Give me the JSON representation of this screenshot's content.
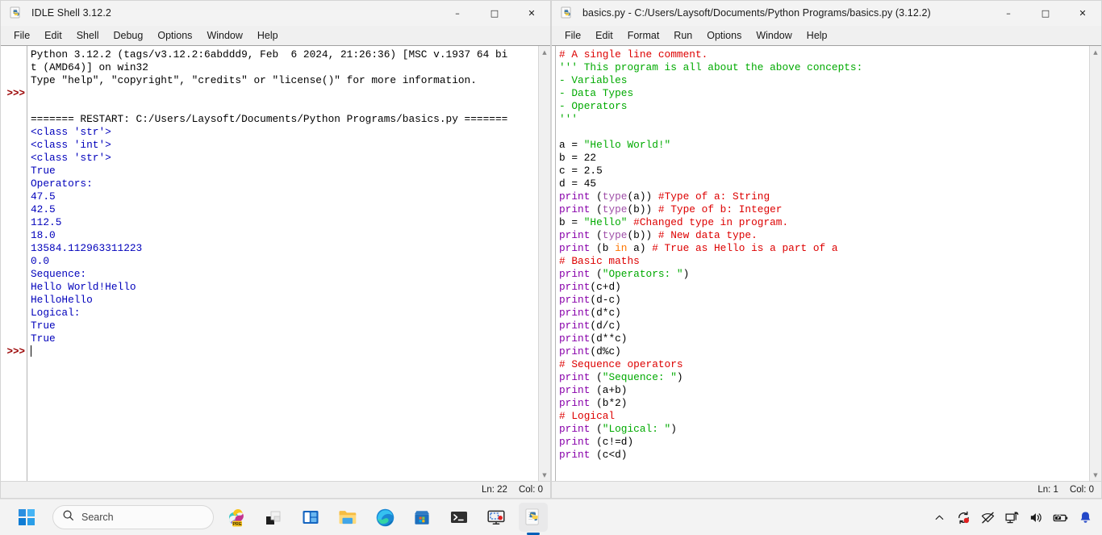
{
  "shell_window": {
    "title": "IDLE Shell 3.12.2",
    "icon": "python-idle-icon",
    "controls": {
      "minimize": "–",
      "maximize": "□",
      "close": "✕"
    },
    "menu": [
      "File",
      "Edit",
      "Shell",
      "Debug",
      "Options",
      "Window",
      "Help"
    ],
    "status": {
      "line": "Ln: 22",
      "col": "Col: 0"
    },
    "lines": [
      {
        "prompt": "",
        "segs": [
          {
            "t": "Python 3.12.2 (tags/v3.12.2:6abddd9, Feb  6 2024, 21:26:36) [MSC v.1937 64 bi",
            "c": "c-black"
          }
        ]
      },
      {
        "prompt": "",
        "segs": [
          {
            "t": "t (AMD64)] on win32",
            "c": "c-black"
          }
        ]
      },
      {
        "prompt": "",
        "segs": [
          {
            "t": "Type \"help\", \"copyright\", \"credits\" or \"license()\" for more information.",
            "c": "c-black"
          }
        ]
      },
      {
        "prompt": ">>>",
        "segs": [
          {
            "t": "",
            "c": "c-black"
          }
        ]
      },
      {
        "prompt": "",
        "segs": [
          {
            "t": "",
            "c": "c-black"
          }
        ]
      },
      {
        "prompt": "",
        "segs": [
          {
            "t": "======= RESTART: C:/Users/Laysoft/Documents/Python Programs/basics.py =======",
            "c": "c-black"
          }
        ]
      },
      {
        "prompt": "",
        "segs": [
          {
            "t": "<class 'str'>",
            "c": "c-out"
          }
        ]
      },
      {
        "prompt": "",
        "segs": [
          {
            "t": "<class 'int'>",
            "c": "c-out"
          }
        ]
      },
      {
        "prompt": "",
        "segs": [
          {
            "t": "<class 'str'>",
            "c": "c-out"
          }
        ]
      },
      {
        "prompt": "",
        "segs": [
          {
            "t": "True",
            "c": "c-out"
          }
        ]
      },
      {
        "prompt": "",
        "segs": [
          {
            "t": "Operators:",
            "c": "c-out"
          }
        ]
      },
      {
        "prompt": "",
        "segs": [
          {
            "t": "47.5",
            "c": "c-out"
          }
        ]
      },
      {
        "prompt": "",
        "segs": [
          {
            "t": "42.5",
            "c": "c-out"
          }
        ]
      },
      {
        "prompt": "",
        "segs": [
          {
            "t": "112.5",
            "c": "c-out"
          }
        ]
      },
      {
        "prompt": "",
        "segs": [
          {
            "t": "18.0",
            "c": "c-out"
          }
        ]
      },
      {
        "prompt": "",
        "segs": [
          {
            "t": "13584.112963311223",
            "c": "c-out"
          }
        ]
      },
      {
        "prompt": "",
        "segs": [
          {
            "t": "0.0",
            "c": "c-out"
          }
        ]
      },
      {
        "prompt": "",
        "segs": [
          {
            "t": "Sequence:",
            "c": "c-out"
          }
        ]
      },
      {
        "prompt": "",
        "segs": [
          {
            "t": "Hello World!Hello",
            "c": "c-out"
          }
        ]
      },
      {
        "prompt": "",
        "segs": [
          {
            "t": "HelloHello",
            "c": "c-out"
          }
        ]
      },
      {
        "prompt": "",
        "segs": [
          {
            "t": "Logical:",
            "c": "c-out"
          }
        ]
      },
      {
        "prompt": "",
        "segs": [
          {
            "t": "True",
            "c": "c-out"
          }
        ]
      },
      {
        "prompt": "",
        "segs": [
          {
            "t": "True",
            "c": "c-out"
          }
        ]
      },
      {
        "prompt": ">>>",
        "segs": [
          {
            "t": "",
            "c": "c-black"
          }
        ],
        "caret": true
      }
    ]
  },
  "editor_window": {
    "title": "basics.py - C:/Users/Laysoft/Documents/Python Programs/basics.py (3.12.2)",
    "icon": "python-file-icon",
    "controls": {
      "minimize": "–",
      "maximize": "□",
      "close": "✕"
    },
    "menu": [
      "File",
      "Edit",
      "Format",
      "Run",
      "Options",
      "Window",
      "Help"
    ],
    "status": {
      "line": "Ln: 1",
      "col": "Col: 0"
    },
    "lines": [
      {
        "segs": [
          {
            "t": "# A single line comment.",
            "c": "c-cmt"
          }
        ]
      },
      {
        "segs": [
          {
            "t": "''' This program is all about the above concepts:",
            "c": "c-str"
          }
        ]
      },
      {
        "segs": [
          {
            "t": "- Variables",
            "c": "c-str"
          }
        ]
      },
      {
        "segs": [
          {
            "t": "- Data Types",
            "c": "c-str"
          }
        ]
      },
      {
        "segs": [
          {
            "t": "- Operators",
            "c": "c-str"
          }
        ]
      },
      {
        "segs": [
          {
            "t": "'''",
            "c": "c-str"
          }
        ]
      },
      {
        "segs": [
          {
            "t": "",
            "c": "c-black"
          }
        ]
      },
      {
        "segs": [
          {
            "t": "a = ",
            "c": "c-black"
          },
          {
            "t": "\"Hello World!\"",
            "c": "c-str"
          }
        ]
      },
      {
        "segs": [
          {
            "t": "b = 22",
            "c": "c-black"
          }
        ]
      },
      {
        "segs": [
          {
            "t": "c = 2.5",
            "c": "c-black"
          }
        ]
      },
      {
        "segs": [
          {
            "t": "d = 45",
            "c": "c-black"
          }
        ]
      },
      {
        "segs": [
          {
            "t": "print",
            "c": "c-def"
          },
          {
            "t": " (",
            "c": "c-black"
          },
          {
            "t": "type",
            "c": "c-bltn"
          },
          {
            "t": "(a)) ",
            "c": "c-black"
          },
          {
            "t": "#Type of a: String",
            "c": "c-cmt"
          }
        ]
      },
      {
        "segs": [
          {
            "t": "print",
            "c": "c-def"
          },
          {
            "t": " (",
            "c": "c-black"
          },
          {
            "t": "type",
            "c": "c-bltn"
          },
          {
            "t": "(b)) ",
            "c": "c-black"
          },
          {
            "t": "# Type of b: Integer",
            "c": "c-cmt"
          }
        ]
      },
      {
        "segs": [
          {
            "t": "b = ",
            "c": "c-black"
          },
          {
            "t": "\"Hello\"",
            "c": "c-str"
          },
          {
            "t": " ",
            "c": "c-black"
          },
          {
            "t": "#Changed type in program.",
            "c": "c-cmt"
          }
        ]
      },
      {
        "segs": [
          {
            "t": "print",
            "c": "c-def"
          },
          {
            "t": " (",
            "c": "c-black"
          },
          {
            "t": "type",
            "c": "c-bltn"
          },
          {
            "t": "(b)) ",
            "c": "c-black"
          },
          {
            "t": "# New data type.",
            "c": "c-cmt"
          }
        ]
      },
      {
        "segs": [
          {
            "t": "print",
            "c": "c-def"
          },
          {
            "t": " (b ",
            "c": "c-black"
          },
          {
            "t": "in",
            "c": "c-kw"
          },
          {
            "t": " a) ",
            "c": "c-black"
          },
          {
            "t": "# True as Hello is a part of a",
            "c": "c-cmt"
          }
        ]
      },
      {
        "segs": [
          {
            "t": "# Basic maths",
            "c": "c-cmt"
          }
        ]
      },
      {
        "segs": [
          {
            "t": "print",
            "c": "c-def"
          },
          {
            "t": " (",
            "c": "c-black"
          },
          {
            "t": "\"Operators: \"",
            "c": "c-str"
          },
          {
            "t": ")",
            "c": "c-black"
          }
        ]
      },
      {
        "segs": [
          {
            "t": "print",
            "c": "c-def"
          },
          {
            "t": "(c+d)",
            "c": "c-black"
          }
        ]
      },
      {
        "segs": [
          {
            "t": "print",
            "c": "c-def"
          },
          {
            "t": "(d-c)",
            "c": "c-black"
          }
        ]
      },
      {
        "segs": [
          {
            "t": "print",
            "c": "c-def"
          },
          {
            "t": "(d*c)",
            "c": "c-black"
          }
        ]
      },
      {
        "segs": [
          {
            "t": "print",
            "c": "c-def"
          },
          {
            "t": "(d/c)",
            "c": "c-black"
          }
        ]
      },
      {
        "segs": [
          {
            "t": "print",
            "c": "c-def"
          },
          {
            "t": "(d**c)",
            "c": "c-black"
          }
        ]
      },
      {
        "segs": [
          {
            "t": "print",
            "c": "c-def"
          },
          {
            "t": "(d%c)",
            "c": "c-black"
          }
        ]
      },
      {
        "segs": [
          {
            "t": "# Sequence operators",
            "c": "c-cmt"
          }
        ]
      },
      {
        "segs": [
          {
            "t": "print",
            "c": "c-def"
          },
          {
            "t": " (",
            "c": "c-black"
          },
          {
            "t": "\"Sequence: \"",
            "c": "c-str"
          },
          {
            "t": ")",
            "c": "c-black"
          }
        ]
      },
      {
        "segs": [
          {
            "t": "print",
            "c": "c-def"
          },
          {
            "t": " (a+b)",
            "c": "c-black"
          }
        ]
      },
      {
        "segs": [
          {
            "t": "print",
            "c": "c-def"
          },
          {
            "t": " (b*2)",
            "c": "c-black"
          }
        ]
      },
      {
        "segs": [
          {
            "t": "# Logical",
            "c": "c-cmt"
          }
        ]
      },
      {
        "segs": [
          {
            "t": "print",
            "c": "c-def"
          },
          {
            "t": " (",
            "c": "c-black"
          },
          {
            "t": "\"Logical: \"",
            "c": "c-str"
          },
          {
            "t": ")",
            "c": "c-black"
          }
        ]
      },
      {
        "segs": [
          {
            "t": "print",
            "c": "c-def"
          },
          {
            "t": " (c!=d)",
            "c": "c-black"
          }
        ]
      },
      {
        "segs": [
          {
            "t": "print",
            "c": "c-def"
          },
          {
            "t": " (c<d)",
            "c": "c-black"
          }
        ]
      }
    ]
  },
  "taskbar": {
    "start_label": "Start",
    "search": {
      "placeholder": "Search",
      "icon": "search-icon"
    },
    "apps": [
      {
        "name": "copilot-icon",
        "badge": "PRE"
      },
      {
        "name": "task-view-icon",
        "badge": ""
      },
      {
        "name": "widgets-icon",
        "badge": ""
      },
      {
        "name": "file-explorer-icon",
        "badge": ""
      },
      {
        "name": "microsoft-edge-icon",
        "badge": ""
      },
      {
        "name": "microsoft-store-icon",
        "badge": ""
      },
      {
        "name": "terminal-icon",
        "badge": ""
      },
      {
        "name": "screen-recorder-icon",
        "badge": ""
      },
      {
        "name": "python-idle-icon",
        "badge": ""
      }
    ],
    "tray": [
      {
        "name": "show-hidden-icons-chevron-icon"
      },
      {
        "name": "windows-update-icon"
      },
      {
        "name": "no-internet-icon"
      },
      {
        "name": "network-display-icon"
      },
      {
        "name": "volume-icon"
      },
      {
        "name": "battery-charging-icon"
      },
      {
        "name": "notifications-bell-icon"
      }
    ]
  },
  "colors": {
    "accent": "#005fb8",
    "output_blue": "#0000bb",
    "comment_red": "#dd0000",
    "string_green": "#00aa00",
    "keyword_orange": "#ff7700",
    "builtin_purple": "#8800aa",
    "prompt_maroon": "#990000"
  }
}
